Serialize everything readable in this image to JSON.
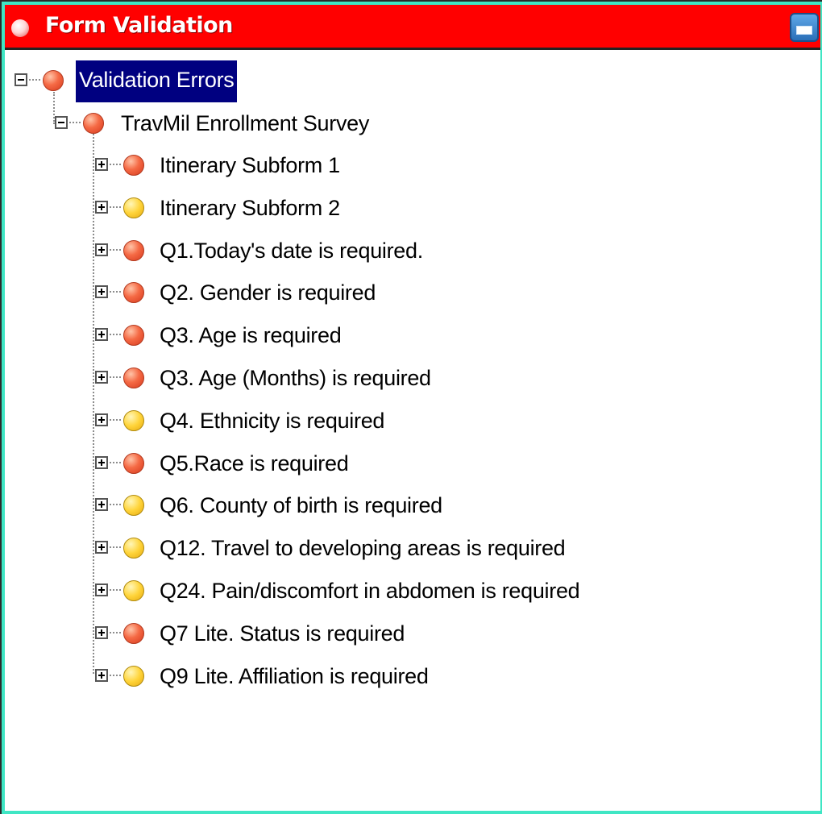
{
  "window": {
    "title": "Form Validation"
  },
  "tree": {
    "root": {
      "label": "Validation Errors",
      "status": "red",
      "expanded": true,
      "selected": true
    },
    "survey": {
      "label": "TravMil Enrollment Survey",
      "status": "red",
      "expanded": true
    },
    "items": [
      {
        "label": "Itinerary Subform 1",
        "status": "red"
      },
      {
        "label": "Itinerary Subform 2",
        "status": "yellow"
      },
      {
        "label": "Q1.Today's date is required.",
        "status": "red"
      },
      {
        "label": "Q2. Gender is required",
        "status": "red"
      },
      {
        "label": "Q3. Age is required",
        "status": "red"
      },
      {
        "label": "Q3. Age (Months) is required",
        "status": "red"
      },
      {
        "label": "Q4. Ethnicity is required",
        "status": "yellow"
      },
      {
        "label": "Q5.Race is required",
        "status": "red"
      },
      {
        "label": "Q6. County of birth is required",
        "status": "yellow"
      },
      {
        "label": "Q12. Travel to developing areas is required",
        "status": "yellow"
      },
      {
        "label": "Q24. Pain/discomfort in abdomen is required",
        "status": "yellow"
      },
      {
        "label": "Q7 Lite. Status is required",
        "status": "red"
      },
      {
        "label": "Q9 Lite. Affiliation is required",
        "status": "yellow"
      }
    ]
  },
  "colors": {
    "titlebar": "#ff0000",
    "frame_border": "#3fe6c4",
    "selection": "#000080",
    "error_red": "#f56a45",
    "warning_yellow": "#ffd43a"
  }
}
